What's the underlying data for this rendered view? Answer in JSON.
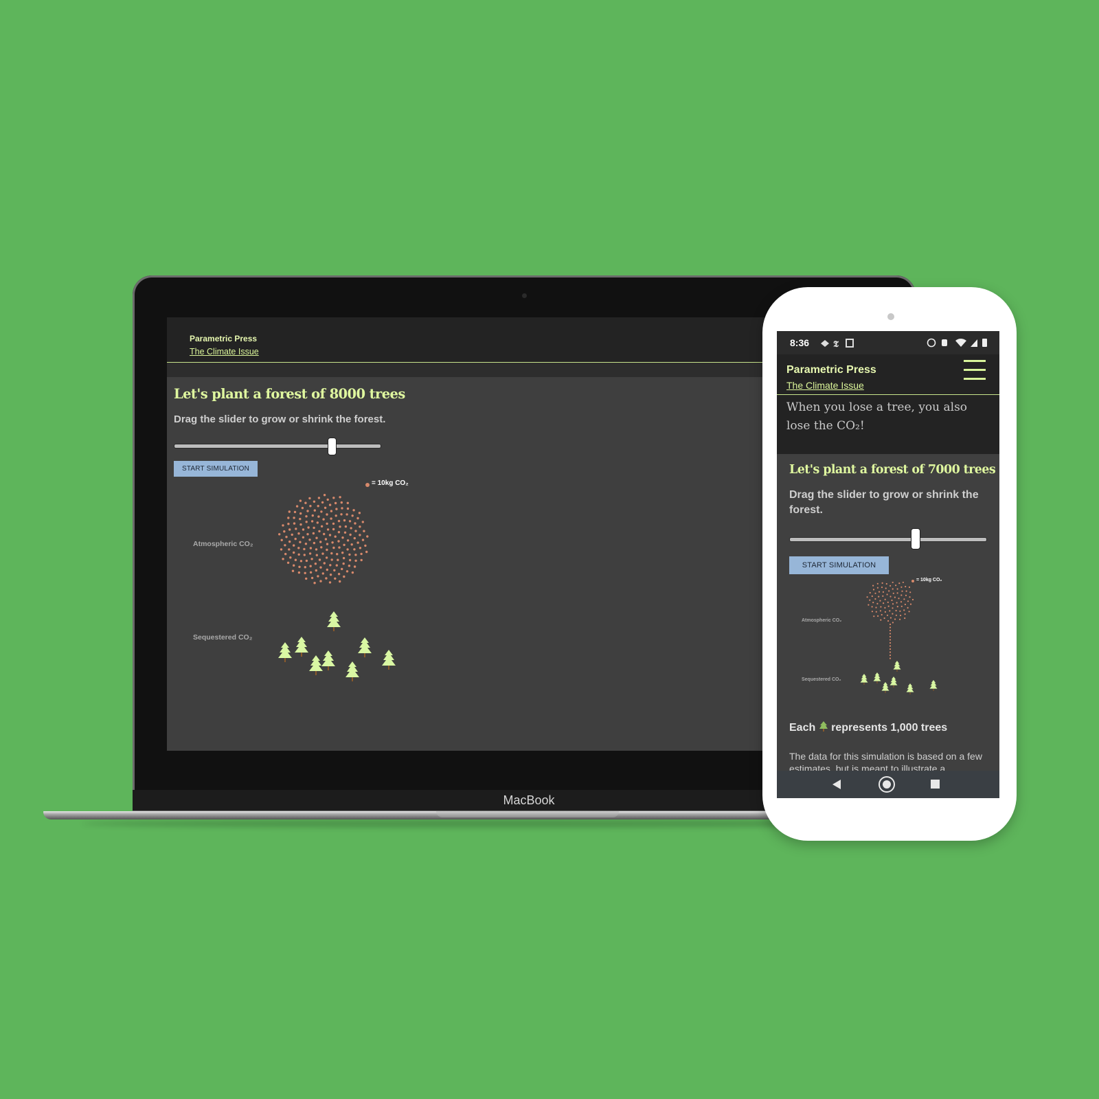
{
  "laptop": {
    "brand": "MacBook",
    "site": {
      "publication": "Parametric Press",
      "issue": "The Climate Issue",
      "heading": "Let's plant a forest of 8000 trees",
      "instruction": "Drag the slider to grow or shrink the forest.",
      "slider_value": 8000,
      "start_button": "START SIMULATION",
      "legend": "= 10kg CO₂",
      "atmospheric_label": "Atmospheric CO₂",
      "sequestered_label": "Sequestered CO₂"
    }
  },
  "phone": {
    "status_bar": {
      "time": "8:36"
    },
    "site": {
      "publication": "Parametric Press",
      "issue": "The Climate Issue",
      "intro_text": "When you lose a tree, you also lose the CO₂!",
      "heading": "Let's plant a forest of 7000 trees",
      "instruction": "Drag the slider to grow or shrink the forest.",
      "slider_value": 7000,
      "start_button": "START SIMULATION",
      "legend": "= 10kg CO₂",
      "atmospheric_label": "Atmospheric CO₂",
      "sequestered_label": "Sequestered CO₂",
      "each_text_prefix": "Each",
      "each_text_suffix": "represents 1,000 trees",
      "body_text": "The data for this simulation is based on a few estimates, but is meant to illustrate a"
    }
  },
  "colors": {
    "background": "#5eb55b",
    "accent": "#dff79f",
    "dot": "#d7896b",
    "tree": "#d9f7a3",
    "button": "#97b6d8"
  }
}
